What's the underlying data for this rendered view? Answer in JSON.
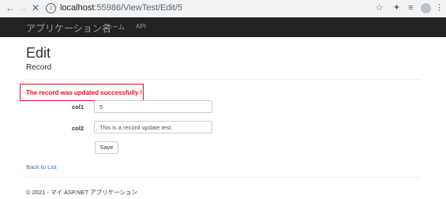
{
  "browser": {
    "url_host": "localhost",
    "url_rest": ":55986/ViewTest/Edit/5"
  },
  "navbar": {
    "brand": "アプリケーション名",
    "links": [
      "ホーム",
      "API"
    ]
  },
  "page": {
    "title": "Edit",
    "subtitle": "Record"
  },
  "alert": {
    "message": "The record was updated successfully !",
    "color": "#e8121f"
  },
  "form": {
    "fields": [
      {
        "label": "col1",
        "value": "5"
      },
      {
        "label": "col2",
        "value": "This is a record update test."
      }
    ],
    "save_label": "Save"
  },
  "back_link": "Back to List",
  "footer": "© 2021 - マイ ASP.NET アプリケーション",
  "icons": {
    "back": "arrow-left-icon",
    "forward": "arrow-right-icon",
    "stop": "close-icon",
    "info": "info-icon",
    "bookmark": "star-icon",
    "extensions": "puzzle-icon",
    "reading_list": "reading-list-icon",
    "profile": "avatar",
    "menu": "kebab-menu-icon"
  }
}
